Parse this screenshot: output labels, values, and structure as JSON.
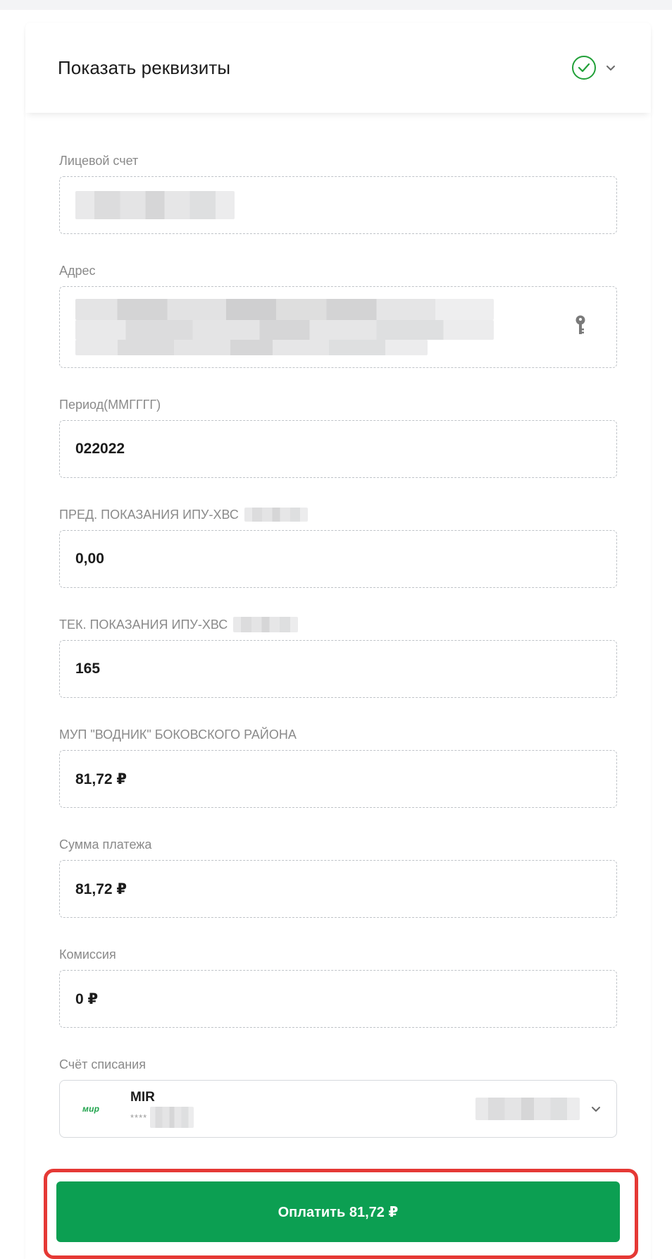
{
  "header": {
    "title": "Показать реквизиты"
  },
  "fields": {
    "account": {
      "label": "Лицевой счет"
    },
    "address": {
      "label": "Адрес"
    },
    "period": {
      "label": "Период(ММГГГГ)",
      "value": "022022"
    },
    "prev_reading": {
      "label": "ПРЕД. ПОКАЗАНИЯ ИПУ-ХВС",
      "value": "0,00"
    },
    "curr_reading": {
      "label": "ТЕК. ПОКАЗАНИЯ ИПУ-ХВС",
      "value": "165"
    },
    "provider": {
      "label": "МУП \"ВОДНИК\" БОКОВСКОГО РАЙОНА",
      "value": "81,72 ₽"
    },
    "amount": {
      "label": "Сумма платежа",
      "value": "81,72 ₽"
    },
    "commission": {
      "label": "Комиссия",
      "value": "0 ₽"
    }
  },
  "debit_account": {
    "label": "Счёт списания",
    "logo_text": "мир",
    "card_name": "MIR",
    "card_mask": "****"
  },
  "pay_button": {
    "label": "Оплатить 81,72 ₽"
  },
  "colors": {
    "accent": "#0c9f52",
    "check": "#21a038",
    "highlight": "#e53935"
  },
  "icons": [
    "check-circle-icon",
    "chevron-down-icon",
    "key-icon",
    "mir-logo"
  ]
}
